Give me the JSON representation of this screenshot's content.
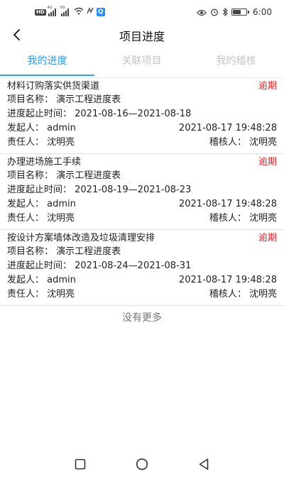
{
  "status_bar": {
    "hd_badge": "HD",
    "sim1_label": "4G",
    "sim2_label": "5G",
    "time": "6:00",
    "battery_level": 0.55,
    "icons": [
      "signal-icon",
      "wifi-icon",
      "nfc-icon",
      "notification-icon",
      "eye-icon",
      "alarm-icon",
      "bluetooth-icon",
      "battery-icon"
    ]
  },
  "header": {
    "title": "项目进度",
    "back_icon": "chevron-left-icon"
  },
  "tabs": [
    {
      "label": "我的进度",
      "active": true
    },
    {
      "label": "关联项目",
      "active": false
    },
    {
      "label": "我的稽核",
      "active": false
    }
  ],
  "items": [
    {
      "title": "材料订购落实供货渠道",
      "status": "逾期",
      "project_line": "项目名称：  演示工程进度表",
      "period_line": "进度起止时间：  2021-08-16—2021-08-18",
      "initiator_line": "发起人：  admin",
      "created_at": "2021-08-17 19:48:28",
      "owner_line": "责任人：  沈明亮",
      "auditor_line": "稽核人：  沈明亮"
    },
    {
      "title": "办理进场施工手续",
      "status": "逾期",
      "project_line": "项目名称：  演示工程进度表",
      "period_line": "进度起止时间：  2021-08-19—2021-08-23",
      "initiator_line": "发起人：  admin",
      "created_at": "2021-08-17 19:48:28",
      "owner_line": "责任人：  沈明亮",
      "auditor_line": "稽核人：  沈明亮"
    },
    {
      "title": "按设计方案墙体改造及垃圾清理安排",
      "status": "逾期",
      "project_line": "项目名称：  演示工程进度表",
      "period_line": "进度起止时间：  2021-08-24—2021-08-31",
      "initiator_line": "发起人：  admin",
      "created_at": "2021-08-17 19:48:28",
      "owner_line": "责任人：  沈明亮",
      "auditor_line": "稽核人：  沈明亮"
    }
  ],
  "footer_text": "没有更多",
  "colors": {
    "accent": "#3a9be0",
    "overdue": "#d9262b",
    "inactive_tab": "#c4c4c4"
  },
  "system_nav": [
    "square-recents-icon",
    "circle-home-icon",
    "triangle-back-icon"
  ]
}
